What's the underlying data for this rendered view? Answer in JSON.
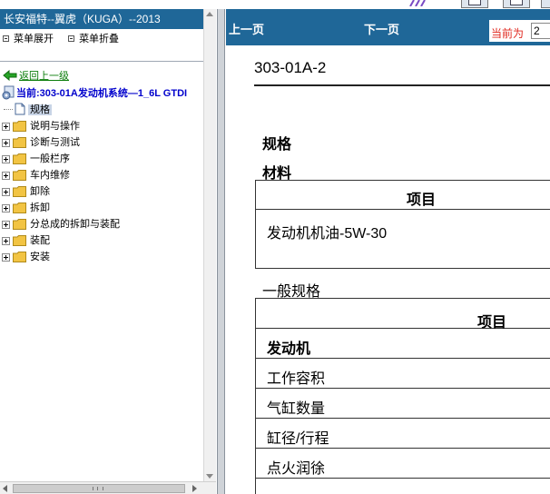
{
  "colors": {
    "title_bar": "#1f6798",
    "back_link": "#0b7d0b",
    "current_node": "#0000cc",
    "current_page_label": "#e0281f",
    "selected_bg": "#c8d4e6",
    "folder": "#f2c443"
  },
  "left_panel": {
    "title": "长安福特--翼虎（KUGA）--2013",
    "menu": {
      "expand": "菜单展开",
      "collapse": "菜单折叠"
    },
    "back": {
      "icon": "green-back-arrow-icon",
      "label": "返回上一级"
    },
    "current": {
      "icon": "gear-document-icon",
      "label": "当前:303-01A发动机系统—1_6L GTDI"
    },
    "selected_item": {
      "icon": "document-icon",
      "label": "规格"
    },
    "tree_items": [
      {
        "icon": "folder-icon",
        "label": "说明与操作"
      },
      {
        "icon": "folder-icon",
        "label": "诊断与测试"
      },
      {
        "icon": "folder-icon",
        "label": "一般栏序"
      },
      {
        "icon": "folder-icon",
        "label": "车内维修"
      },
      {
        "icon": "folder-icon",
        "label": "卸除"
      },
      {
        "icon": "folder-icon",
        "label": "拆卸"
      },
      {
        "icon": "folder-icon",
        "label": "分总成的拆卸与装配"
      },
      {
        "icon": "folder-icon",
        "label": "装配"
      },
      {
        "icon": "folder-icon",
        "label": "安装"
      }
    ]
  },
  "right_panel": {
    "nav": {
      "prev": "上一页",
      "next": "下一页",
      "current_label": "当前为",
      "page_value": "2"
    },
    "doc": {
      "title": "303-01A-2",
      "section_spec": "规格",
      "section_materials": "材料",
      "materials_table": {
        "header": "项目",
        "rows": [
          "发动机机油-5W-30"
        ]
      },
      "section_general": "一般规格",
      "general_table": {
        "header": "项目",
        "rows": [
          "发动机",
          "工作容积",
          "气缸数量",
          "缸径/行程",
          "点火润徐"
        ]
      }
    }
  }
}
